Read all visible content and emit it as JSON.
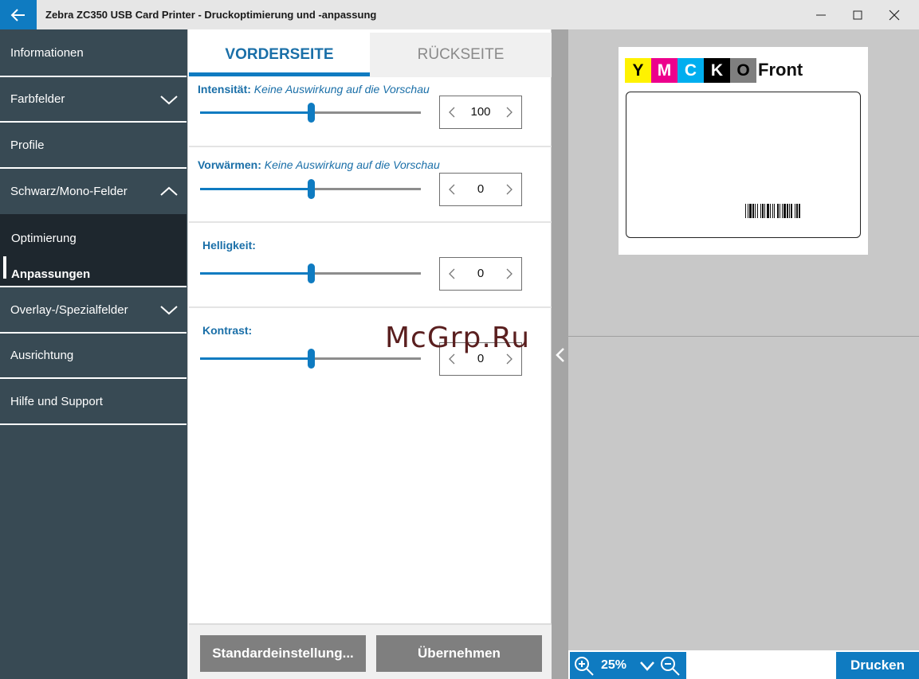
{
  "window": {
    "title": "Zebra ZC350 USB Card Printer - Druckoptimierung und -anpassung"
  },
  "sidebar": {
    "items": [
      {
        "label": "Informationen"
      },
      {
        "label": "Farbfelder"
      },
      {
        "label": "Profile"
      },
      {
        "label": "Schwarz/Mono-Felder"
      },
      {
        "label": "Overlay-/Spezialfelder"
      },
      {
        "label": "Ausrichtung"
      },
      {
        "label": "Hilfe und Support"
      }
    ],
    "subitems": [
      {
        "label": "Optimierung"
      },
      {
        "label": "Anpassungen"
      }
    ]
  },
  "tabs": {
    "front": "VORDERSEITE",
    "back": "RÜCKSEITE"
  },
  "settings": [
    {
      "label": "Intensität:",
      "note": "Keine Auswirkung auf die Vorschau",
      "value": "100",
      "level": 0.5
    },
    {
      "label": "Vorwärmen:",
      "note": "Keine Auswirkung auf die Vorschau",
      "value": "0",
      "level": 0.5
    },
    {
      "label": "Helligkeit:",
      "note": "",
      "value": "0",
      "level": 0.5
    },
    {
      "label": "Kontrast:",
      "note": "",
      "value": "0",
      "level": 0.5
    }
  ],
  "buttons": {
    "defaults": "Standardeinstellung...",
    "apply": "Übernehmen",
    "print": "Drucken"
  },
  "preview": {
    "ribbon_panels": [
      "Y",
      "M",
      "C",
      "K",
      "O"
    ],
    "ribbon_colors": [
      "#fff200",
      "#ec008c",
      "#00aeef",
      "#000000",
      "#7f7f7f"
    ],
    "ribbon_text_colors": [
      "#000000",
      "#ffffff",
      "#ffffff",
      "#ffffff",
      "#000000"
    ],
    "side_label": "Front"
  },
  "zoom": {
    "value": "25%"
  },
  "watermark": "McGrp.Ru",
  "colors": {
    "accent": "#0f7bc1",
    "sidebar": "#384a54",
    "sidebar_active": "#1e272e"
  }
}
